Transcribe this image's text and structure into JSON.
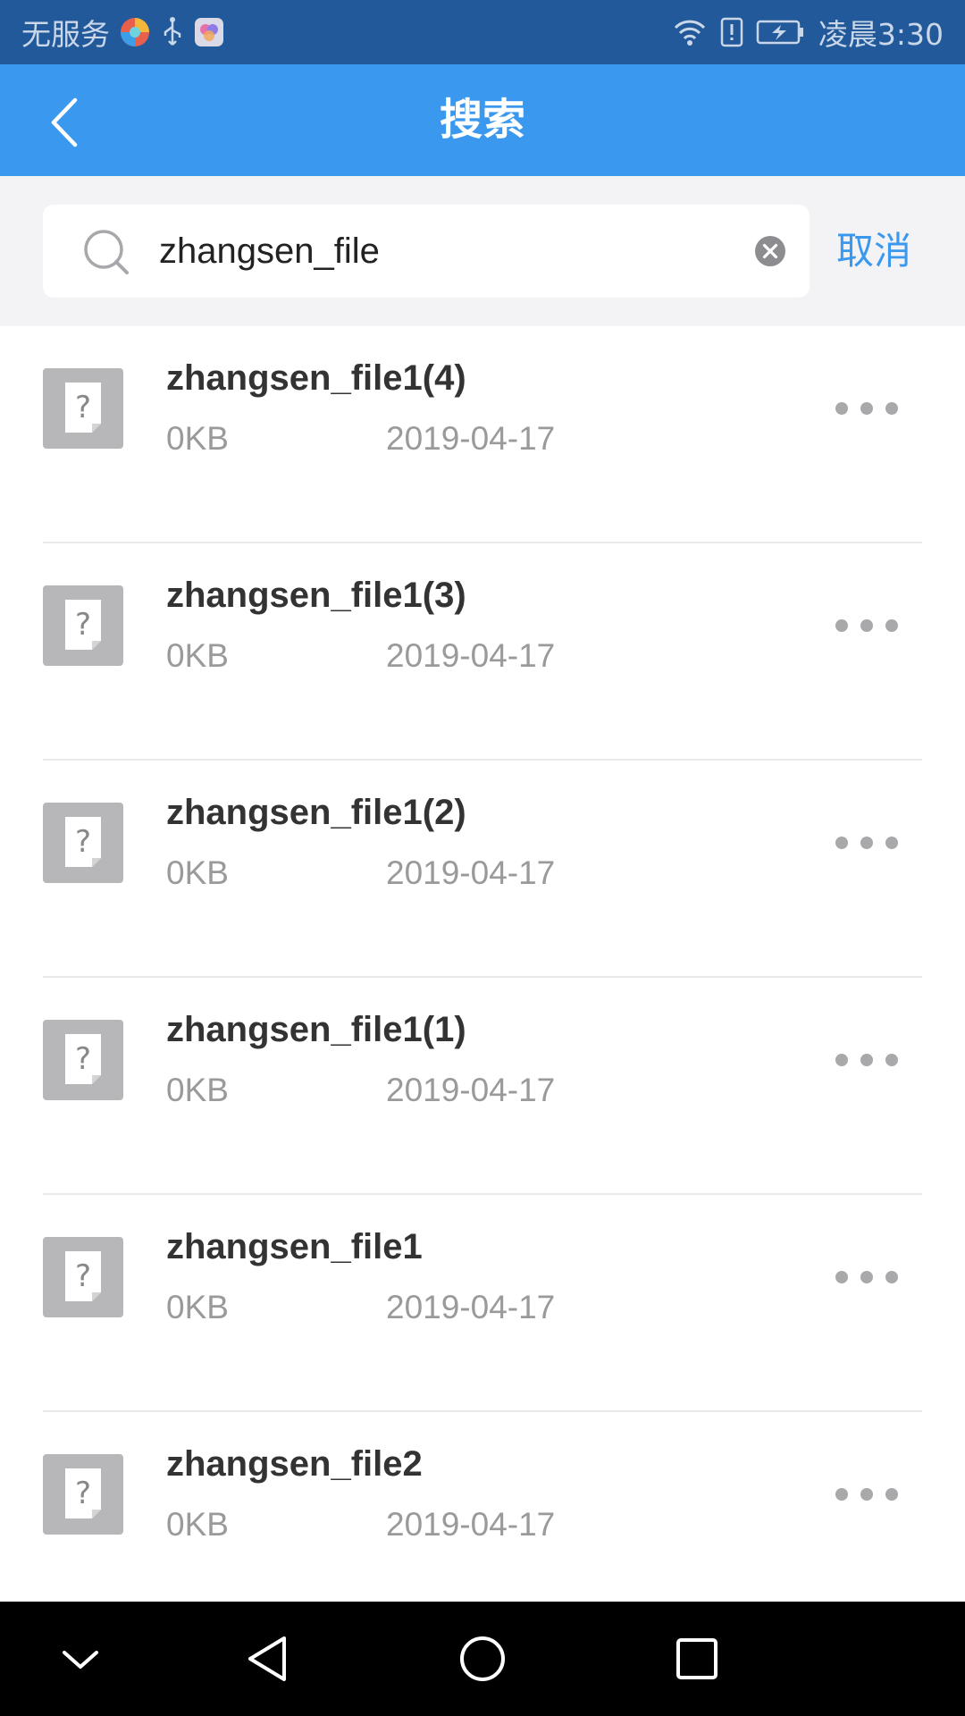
{
  "status_bar": {
    "carrier": "无服务",
    "time": "凌晨3:30",
    "icons": [
      "browser-app-icon",
      "usb-icon",
      "app-icon",
      "wifi-icon",
      "alert-icon",
      "battery-charging-icon"
    ]
  },
  "header": {
    "title": "搜索",
    "back_icon": "chevron-left-icon"
  },
  "search": {
    "value": "zhangsen_file",
    "cancel_label": "取消",
    "icons": [
      "search-icon",
      "clear-icon"
    ]
  },
  "files": [
    {
      "name": "zhangsen_file1(4)",
      "size": "0KB",
      "date": "2019-04-17"
    },
    {
      "name": "zhangsen_file1(3)",
      "size": "0KB",
      "date": "2019-04-17"
    },
    {
      "name": "zhangsen_file1(2)",
      "size": "0KB",
      "date": "2019-04-17"
    },
    {
      "name": "zhangsen_file1(1)",
      "size": "0KB",
      "date": "2019-04-17"
    },
    {
      "name": "zhangsen_file1",
      "size": "0KB",
      "date": "2019-04-17"
    },
    {
      "name": "zhangsen_file2",
      "size": "0KB",
      "date": "2019-04-17"
    }
  ],
  "nav_bar": {
    "icons": [
      "collapse-icon",
      "back-triangle-icon",
      "home-circle-icon",
      "recents-square-icon"
    ]
  },
  "colors": {
    "status_bar": "#22599a",
    "title_bar": "#3a98ee",
    "accent": "#3a98ee",
    "search_area_bg": "#f3f3f5"
  }
}
